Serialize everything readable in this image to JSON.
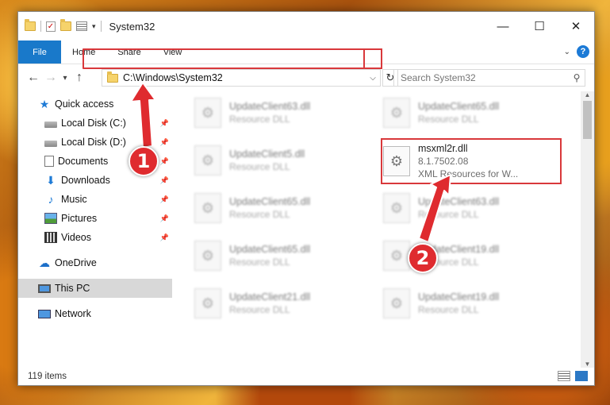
{
  "window": {
    "title": "System32"
  },
  "ribbon": {
    "tabs": [
      "File",
      "Home",
      "Share",
      "View"
    ]
  },
  "navbar": {
    "address": "C:\\Windows\\System32",
    "search_placeholder": "Search System32"
  },
  "sidebar": {
    "quick_access": "Quick access",
    "items": [
      {
        "label": "Local Disk (C:)"
      },
      {
        "label": "Local Disk (D:)"
      },
      {
        "label": "Documents"
      },
      {
        "label": "Downloads"
      },
      {
        "label": "Music"
      },
      {
        "label": "Pictures"
      },
      {
        "label": "Videos"
      }
    ],
    "onedrive": "OneDrive",
    "this_pc": "This PC",
    "network": "Network"
  },
  "files": {
    "left": [
      {
        "name": "UpdateClient63.dll",
        "sub": "Resource DLL"
      },
      {
        "name": "UpdateClient5.dll",
        "sub": "Resource DLL"
      },
      {
        "name": "UpdateClient65.dll",
        "sub": "Resource DLL"
      },
      {
        "name": "UpdateClient65.dll",
        "sub": "Resource DLL"
      },
      {
        "name": "UpdateClient21.dll",
        "sub": "Resource DLL"
      }
    ],
    "right": [
      {
        "name": "UpdateClient65.dll",
        "sub": "Resource DLL"
      },
      {
        "name": "UpdateClient63.dll",
        "sub": "Resource DLL"
      },
      {
        "name": "UpdateClient19.dll",
        "sub": "Resource DLL"
      },
      {
        "name": "UpdateClient19.dll",
        "sub": "Resource DLL"
      }
    ],
    "target": {
      "name": "msxml2r.dll",
      "version": "8.1.7502.08",
      "description": "XML Resources for W..."
    }
  },
  "status": {
    "count": "119 items"
  },
  "callouts": {
    "one": "1",
    "two": "2"
  },
  "colors": {
    "accent": "#1979ca",
    "highlight": "#d9383b"
  }
}
